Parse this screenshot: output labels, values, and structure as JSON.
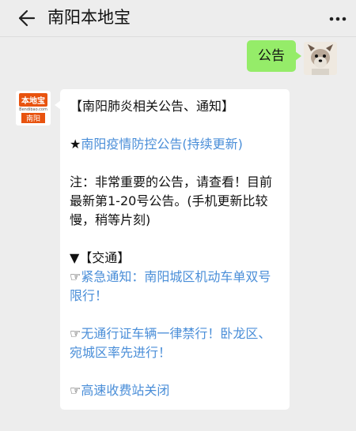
{
  "header": {
    "title": "南阳本地宝",
    "back_icon": "back-arrow-icon",
    "more_icon": "more-dots-icon"
  },
  "messages": {
    "outgoing": {
      "text": "公告",
      "avatar": "dog-avatar"
    },
    "incoming": {
      "avatar_logo": {
        "top": "本地宝",
        "sub": "Bendibao.com",
        "city": "南阳"
      },
      "heading": "【南阳肺炎相关公告、通知】",
      "star": "★",
      "link1": "南阳疫情防控公告(持续更新)",
      "note": "注：非常重要的公告，请查看！目前最新第1-20号公告。(手机更新比较慢，稍等片刻)",
      "section": "▼【交通】",
      "hand": "☞",
      "link2": "紧急通知：南阳城区机动车单双号限行！",
      "link3": "无通行证车辆一律禁行！卧龙区、宛城区率先进行！",
      "link4": "高速收费站关闭"
    }
  },
  "colors": {
    "accent_green": "#95ec69",
    "link_blue": "#4a8ed8",
    "brand_orange": "#e8530f"
  }
}
